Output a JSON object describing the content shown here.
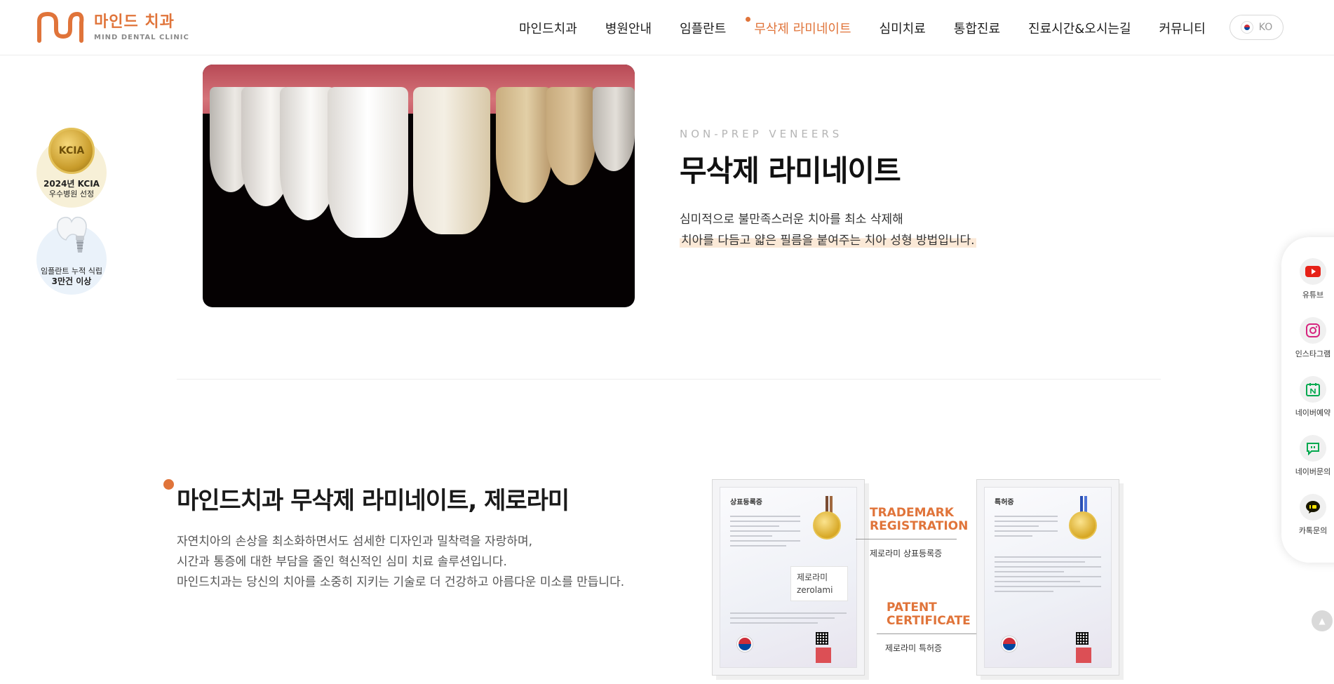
{
  "header": {
    "logo": {
      "ko": "마인드 치과",
      "en": "MIND DENTAL CLINIC"
    },
    "nav": [
      {
        "label": "마인드치과",
        "active": false
      },
      {
        "label": "병원안내",
        "active": false
      },
      {
        "label": "임플란트",
        "active": false
      },
      {
        "label": "무삭제 라미네이트",
        "active": true
      },
      {
        "label": "심미치료",
        "active": false
      },
      {
        "label": "통합진료",
        "active": false
      },
      {
        "label": "진료시간&오시는길",
        "active": false
      },
      {
        "label": "커뮤니티",
        "active": false
      }
    ],
    "lang": "KO"
  },
  "badges": [
    {
      "mark": "KCIA",
      "line1": "2024년 KCIA",
      "line2": "우수병원 선정"
    },
    {
      "line1": "임플란트 누적 식립",
      "line2": "3만건 이상"
    }
  ],
  "hero": {
    "eyebrow": "NON-PREP VENEERS",
    "title": "무삭제 라미네이트",
    "desc1": "심미적으로 불만족스러운 치아를 최소 삭제해",
    "desc2": "치아를 다듬고 얇은 필름을 붙여주는 치아 성형 방법입니다."
  },
  "section2": {
    "title": "마인드치과 무삭제 라미네이트, 제로라미",
    "lines": [
      "자연치아의 손상을 최소화하면서도 섬세한 디자인과 밀착력을 자랑하며,",
      "시간과 통증에 대한 부담을 줄인 혁신적인 심미 치료 솔루션입니다.",
      "마인드치과는 당신의 치아를 소중히 지키는 기술로 더 건강하고 아름다운 미소를 만듭니다."
    ]
  },
  "certificates": {
    "trademark": {
      "doc_title": "상표등록증",
      "name_ko": "제로라미",
      "name_en": "zerolami",
      "label_en_1": "TRADEMARK",
      "label_en_2": "REGISTRATION",
      "label_ko": "제로라미 상표등록증"
    },
    "patent": {
      "doc_title": "특허증",
      "label_en_1": "PATENT",
      "label_en_2": "CERTIFICATE",
      "label_ko": "제로라미 특허증"
    }
  },
  "side_menu": [
    {
      "label": "유튜브",
      "icon": "youtube-icon"
    },
    {
      "label": "인스타그램",
      "icon": "instagram-icon"
    },
    {
      "label": "네이버예약",
      "icon": "naver-booking-icon"
    },
    {
      "label": "네이버문의",
      "icon": "naver-talk-icon"
    },
    {
      "label": "카톡문의",
      "icon": "kakaotalk-icon"
    }
  ],
  "colors": {
    "accent": "#e0743a"
  }
}
